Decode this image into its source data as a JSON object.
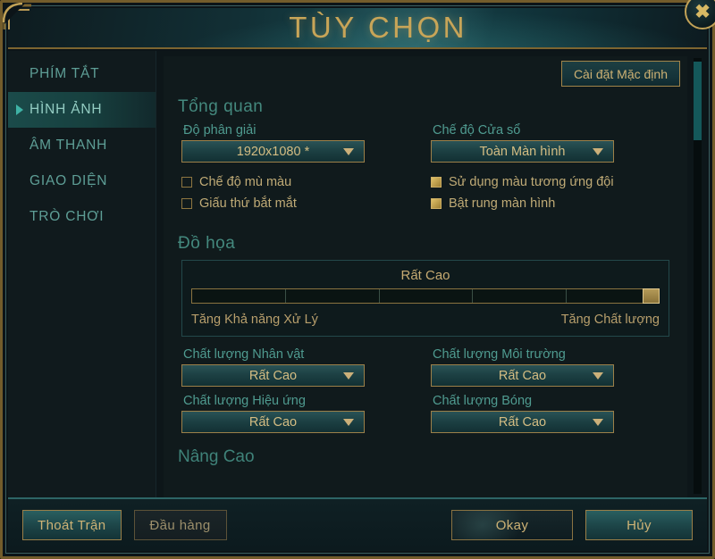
{
  "window": {
    "title": "TÙY CHỌN",
    "close_icon": "close-x-icon",
    "accent_gold": "#c8a558",
    "accent_teal": "#3fb3a6"
  },
  "sidebar": {
    "items": [
      {
        "label": "PHÍM TẮT",
        "active": false
      },
      {
        "label": "HÌNH ẢNH",
        "active": true
      },
      {
        "label": "ÂM THANH",
        "active": false
      },
      {
        "label": "GIAO DIỆN",
        "active": false
      },
      {
        "label": "TRÒ CHƠI",
        "active": false
      }
    ]
  },
  "content": {
    "default_settings_label": "Cài đặt Mặc định",
    "overview": {
      "title": "Tổng quan",
      "resolution_label": "Độ phân giải",
      "resolution_value": "1920x1080 *",
      "window_mode_label": "Chế độ Cửa sổ",
      "window_mode_value": "Toàn Màn hình",
      "checkboxes": [
        {
          "label": "Chế độ mù màu",
          "checked": false
        },
        {
          "label": "Giấu thứ bắt mắt",
          "checked": false
        },
        {
          "label": "Sử dụng màu tương ứng đội",
          "checked": true
        },
        {
          "label": "Bật rung màn hình",
          "checked": true
        }
      ]
    },
    "graphics": {
      "title": "Đồ họa",
      "slider_value": "Rất Cao",
      "slider_percent": 100,
      "left_end_label": "Tăng Khả năng Xử Lý",
      "right_end_label": "Tăng Chất lượng",
      "quality": [
        {
          "label": "Chất lượng Nhân vật",
          "value": "Rất Cao"
        },
        {
          "label": "Chất lượng Môi trường",
          "value": "Rất Cao"
        },
        {
          "label": "Chất lượng Hiệu ứng",
          "value": "Rất Cao"
        },
        {
          "label": "Chất lượng Bóng",
          "value": "Rất Cao"
        }
      ]
    },
    "advanced": {
      "title": "Nâng Cao"
    }
  },
  "footer": {
    "quit_label": "Thoát Trận",
    "surrender_label": "Đầu hàng",
    "okay_label": "Okay",
    "cancel_label": "Hủy"
  }
}
